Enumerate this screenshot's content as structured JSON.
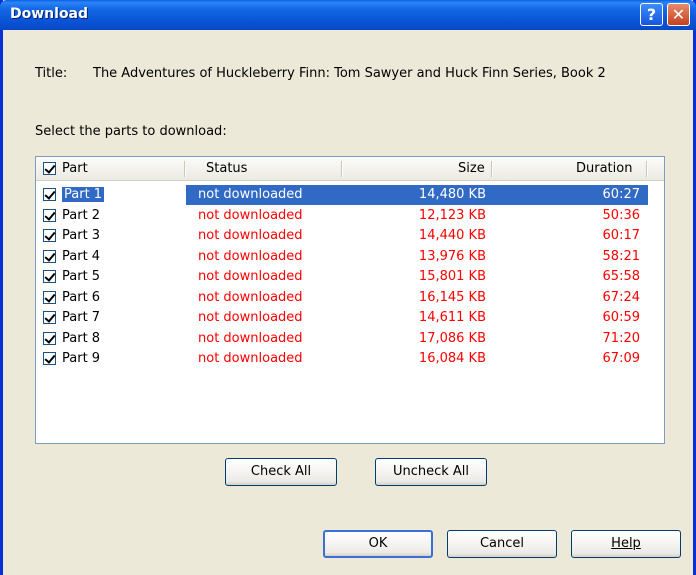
{
  "window": {
    "title": "Download"
  },
  "titlebar": {
    "help_glyph": "?",
    "close_glyph": "✕"
  },
  "book": {
    "label": "Title:",
    "value": "The Adventures of Huckleberry Finn: Tom Sawyer and Huck Finn Series, Book 2"
  },
  "list": {
    "prompt": "Select the parts to download:",
    "columns": {
      "part": "Part",
      "status": "Status",
      "size": "Size",
      "duration": "Duration"
    },
    "rows": [
      {
        "part": "Part 1",
        "status": "not downloaded",
        "size": "14,480 KB",
        "duration": "60:27",
        "checked": true
      },
      {
        "part": "Part 2",
        "status": "not downloaded",
        "size": "12,123 KB",
        "duration": "50:36",
        "checked": true
      },
      {
        "part": "Part 3",
        "status": "not downloaded",
        "size": "14,440 KB",
        "duration": "60:17",
        "checked": true
      },
      {
        "part": "Part 4",
        "status": "not downloaded",
        "size": "13,976 KB",
        "duration": "58:21",
        "checked": true
      },
      {
        "part": "Part 5",
        "status": "not downloaded",
        "size": "15,801 KB",
        "duration": "65:58",
        "checked": true
      },
      {
        "part": "Part 6",
        "status": "not downloaded",
        "size": "16,145 KB",
        "duration": "67:24",
        "checked": true
      },
      {
        "part": "Part 7",
        "status": "not downloaded",
        "size": "14,611 KB",
        "duration": "60:59",
        "checked": true
      },
      {
        "part": "Part 8",
        "status": "not downloaded",
        "size": "17,086 KB",
        "duration": "71:20",
        "checked": true
      },
      {
        "part": "Part 9",
        "status": "not downloaded",
        "size": "16,084 KB",
        "duration": "67:09",
        "checked": true
      }
    ],
    "status_color": "#ff0000",
    "selection_color": "#316ac5"
  },
  "buttons": {
    "check_all": "Check All",
    "uncheck_all": "Uncheck All",
    "ok": "OK",
    "cancel": "Cancel",
    "help": "Help"
  }
}
